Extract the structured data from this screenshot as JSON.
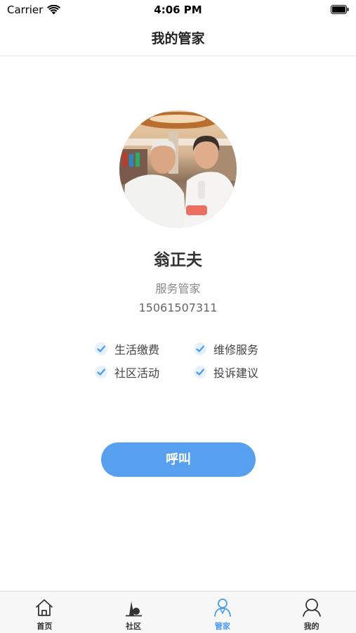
{
  "status_bar": {
    "carrier": "Carrier",
    "time": "4:06 PM"
  },
  "nav": {
    "title": "我的管家"
  },
  "profile": {
    "name": "翁正夫",
    "role": "服务管家",
    "phone": "15061507311"
  },
  "services": [
    {
      "label": "生活缴费",
      "checked": true
    },
    {
      "label": "维修服务",
      "checked": true
    },
    {
      "label": "社区活动",
      "checked": true
    },
    {
      "label": "投诉建议",
      "checked": true
    }
  ],
  "call_button": {
    "label": "呼叫"
  },
  "tabs": [
    {
      "label": "首页",
      "icon": "home-icon",
      "active": false
    },
    {
      "label": "社区",
      "icon": "community-icon",
      "active": false
    },
    {
      "label": "管家",
      "icon": "butler-icon",
      "active": true
    },
    {
      "label": "我的",
      "icon": "profile-icon",
      "active": false
    }
  ],
  "colors": {
    "accent": "#4a9bec",
    "button": "#56a0ef",
    "check": "#4a9bec"
  }
}
